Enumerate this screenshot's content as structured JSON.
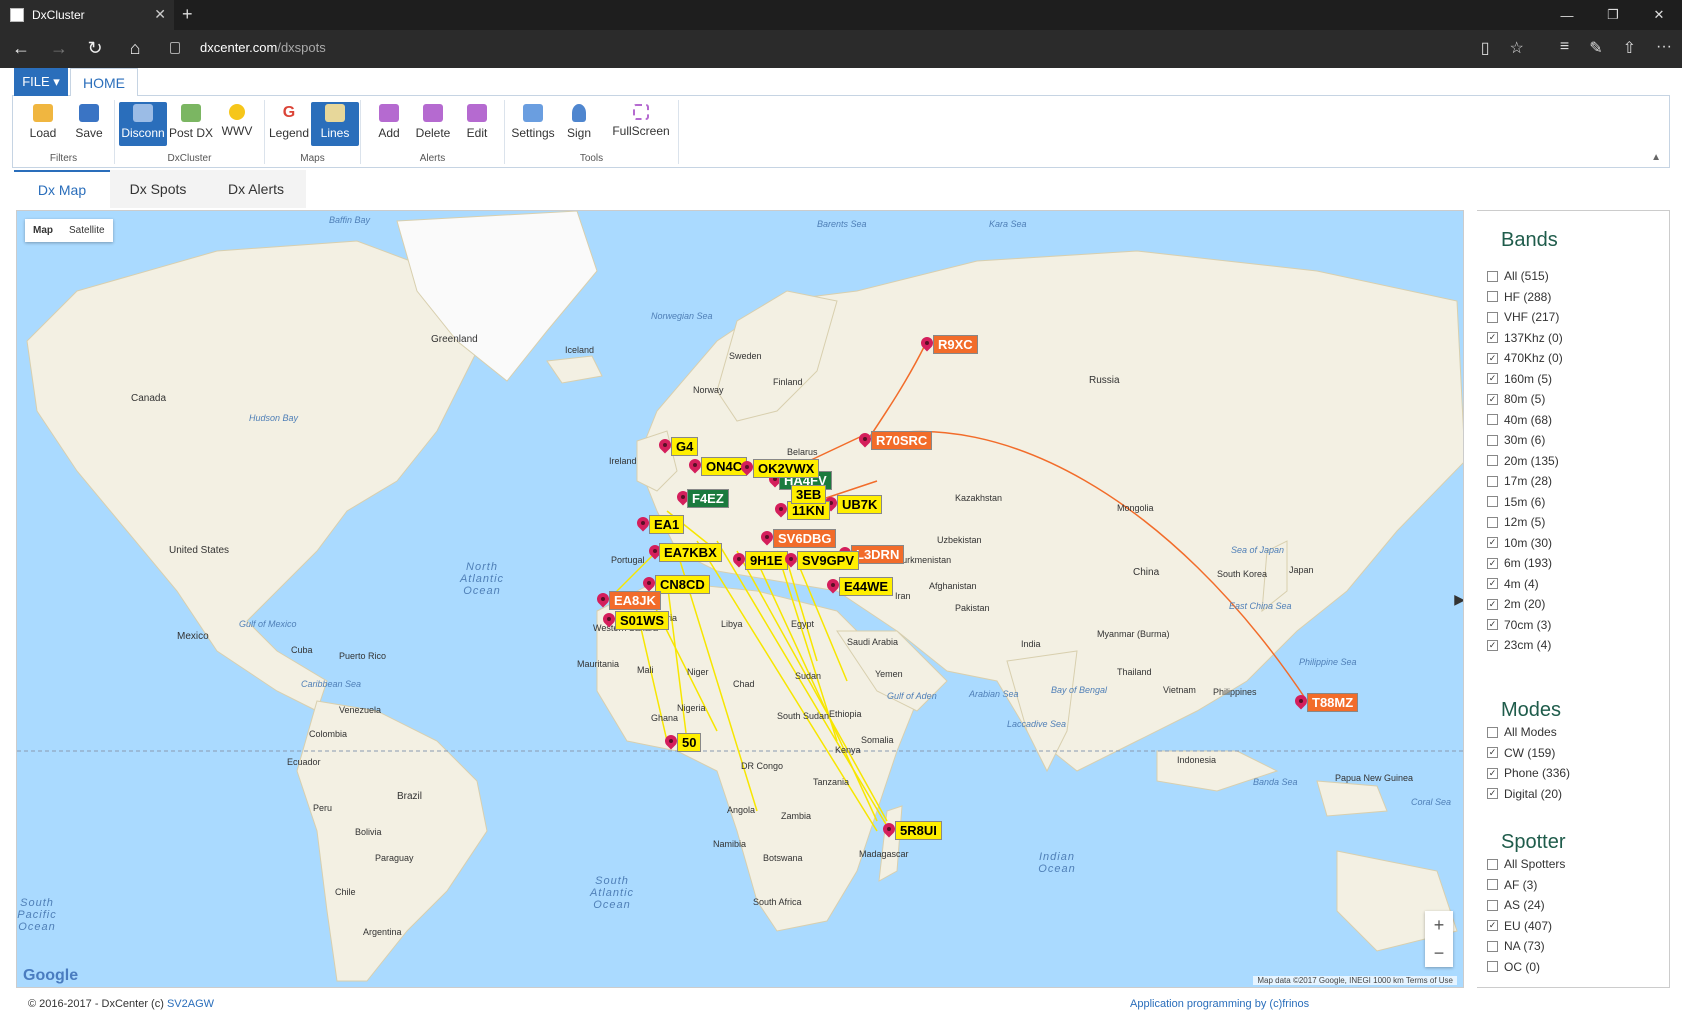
{
  "browser": {
    "tab_title": "DxCluster",
    "url_domain": "dxcenter.com",
    "url_path": "/dxspots"
  },
  "ribbon": {
    "file_tab": "FILE ▾",
    "home_tab": "HOME",
    "groups": [
      {
        "label": "Filters",
        "buttons": [
          "Load",
          "Save"
        ]
      },
      {
        "label": "DxCluster",
        "buttons": [
          "Disconn",
          "Post DX",
          "WWV"
        ]
      },
      {
        "label": "Maps",
        "buttons": [
          "Legend",
          "Lines"
        ]
      },
      {
        "label": "Alerts",
        "buttons": [
          "Add",
          "Delete",
          "Edit"
        ]
      },
      {
        "label": "Tools",
        "buttons": [
          "Settings",
          "Sign",
          "FullScreen"
        ]
      }
    ]
  },
  "content_tabs": [
    "Dx Map",
    "Dx Spots",
    "Dx Alerts"
  ],
  "map": {
    "type_map": "Map",
    "type_satellite": "Satellite",
    "attribution": "Map data ©2017 Google, INEGI   1000 km   Terms of Use",
    "google": "Google",
    "countries": [
      "Greenland",
      "Iceland",
      "Canada",
      "United States",
      "Mexico",
      "Cuba",
      "Puerto Rico",
      "Venezuela",
      "Colombia",
      "Ecuador",
      "Peru",
      "Brazil",
      "Bolivia",
      "Paraguay",
      "Chile",
      "Argentina",
      "Sweden",
      "Norway",
      "Finland",
      "Ireland",
      "Russia",
      "Kazakhstan",
      "Mongolia",
      "China",
      "Japan",
      "South Korea",
      "India",
      "Iran",
      "Afghanistan",
      "Pakistan",
      "Uzbekistan",
      "Turkmenistan",
      "Saudi Arabia",
      "Egypt",
      "Libya",
      "Algeria",
      "Mali",
      "Niger",
      "Chad",
      "Sudan",
      "Mauritania",
      "Nigeria",
      "Ethiopia",
      "Somalia",
      "Kenya",
      "Tanzania",
      "DR Congo",
      "Angola",
      "Zambia",
      "Namibia",
      "Botswana",
      "South Africa",
      "Madagascar",
      "Yemen",
      "Thailand",
      "Vietnam",
      "Philippines",
      "Indonesia",
      "Papua New Guinea",
      "Belarus",
      "Portugal",
      "Western Sahara",
      "South Sudan",
      "Ghana",
      "Myanmar (Burma)"
    ],
    "seas": [
      "Baffin Bay",
      "Hudson Bay",
      "Barents Sea",
      "Kara Sea",
      "Norwegian Sea",
      "Gulf of Mexico",
      "Caribbean Sea",
      "Arabian Sea",
      "Bay of Bengal",
      "Sea of Japan",
      "East China Sea",
      "Philippine Sea",
      "Gulf of Aden",
      "Laccadive Sea",
      "Banda Sea",
      "Coral Sea"
    ],
    "oceans": [
      "North Atlantic Ocean",
      "South Atlantic Ocean",
      "Indian Ocean",
      "South Pacific Ocean"
    ],
    "spots": [
      {
        "call": "R9XC",
        "color": "o"
      },
      {
        "call": "R70SRC",
        "color": "o"
      },
      {
        "call": "T88MZ",
        "color": "o"
      },
      {
        "call": "HA4FV",
        "color": "g"
      },
      {
        "call": "UB7K",
        "color": "y"
      },
      {
        "call": "ON4C",
        "color": "y"
      },
      {
        "call": "OK2VWX",
        "color": "y"
      },
      {
        "call": "G4",
        "color": "y"
      },
      {
        "call": "F4EZ",
        "color": "g"
      },
      {
        "call": "EA1",
        "color": "y"
      },
      {
        "call": "SV6DBG",
        "color": "o"
      },
      {
        "call": "L3DRN",
        "color": "o"
      },
      {
        "call": "EA7KBX",
        "color": "y"
      },
      {
        "call": "9H1E",
        "color": "y"
      },
      {
        "call": "SV9GPV",
        "color": "y"
      },
      {
        "call": "CN8CD",
        "color": "y"
      },
      {
        "call": "E44WE",
        "color": "y"
      },
      {
        "call": "EA8JK",
        "color": "o"
      },
      {
        "call": "S01WS",
        "color": "y"
      },
      {
        "call": "50",
        "color": "y"
      },
      {
        "call": "5R8UI",
        "color": "y"
      },
      {
        "call": "11KN",
        "color": "y"
      },
      {
        "call": "3EB",
        "color": "y"
      }
    ]
  },
  "sidebar": {
    "bands_title": "Bands",
    "bands": [
      {
        "label": "All (515)",
        "checked": false
      },
      {
        "label": "HF (288)",
        "checked": false
      },
      {
        "label": "VHF (217)",
        "checked": false
      },
      {
        "label": "137Khz (0)",
        "checked": true
      },
      {
        "label": "470Khz (0)",
        "checked": true
      },
      {
        "label": "160m (5)",
        "checked": true
      },
      {
        "label": "80m (5)",
        "checked": true
      },
      {
        "label": "40m (68)",
        "checked": false
      },
      {
        "label": "30m (6)",
        "checked": false
      },
      {
        "label": "20m (135)",
        "checked": false
      },
      {
        "label": "17m (28)",
        "checked": false
      },
      {
        "label": "15m (6)",
        "checked": false
      },
      {
        "label": "12m (5)",
        "checked": false
      },
      {
        "label": "10m (30)",
        "checked": true
      },
      {
        "label": "6m (193)",
        "checked": true
      },
      {
        "label": "4m (4)",
        "checked": true
      },
      {
        "label": "2m (20)",
        "checked": true
      },
      {
        "label": "70cm (3)",
        "checked": true
      },
      {
        "label": "23cm (4)",
        "checked": true
      }
    ],
    "modes_title": "Modes",
    "modes": [
      {
        "label": "All Modes",
        "checked": false
      },
      {
        "label": "CW (159)",
        "checked": true
      },
      {
        "label": "Phone (336)",
        "checked": true
      },
      {
        "label": "Digital (20)",
        "checked": true
      }
    ],
    "spotter_title": "Spotter",
    "spotters": [
      {
        "label": "All Spotters",
        "checked": false
      },
      {
        "label": "AF (3)",
        "checked": false
      },
      {
        "label": "AS (24)",
        "checked": false
      },
      {
        "label": "EU (407)",
        "checked": true
      },
      {
        "label": "NA (73)",
        "checked": false
      },
      {
        "label": "OC (0)",
        "checked": false
      }
    ]
  },
  "footer": {
    "copyright": "© 2016-2017 - DxCenter (c) ",
    "copyright_link": "SV2AGW",
    "credit": "Application programming by (c)frinos"
  },
  "colors": {
    "accent": "#2a6ebb",
    "pin": "#d41f5c",
    "spot_yellow": "#ffef00",
    "spot_orange": "#f26c2a",
    "spot_green": "#1b7a3e",
    "water": "#aadaff",
    "land": "#f4f1e6"
  }
}
